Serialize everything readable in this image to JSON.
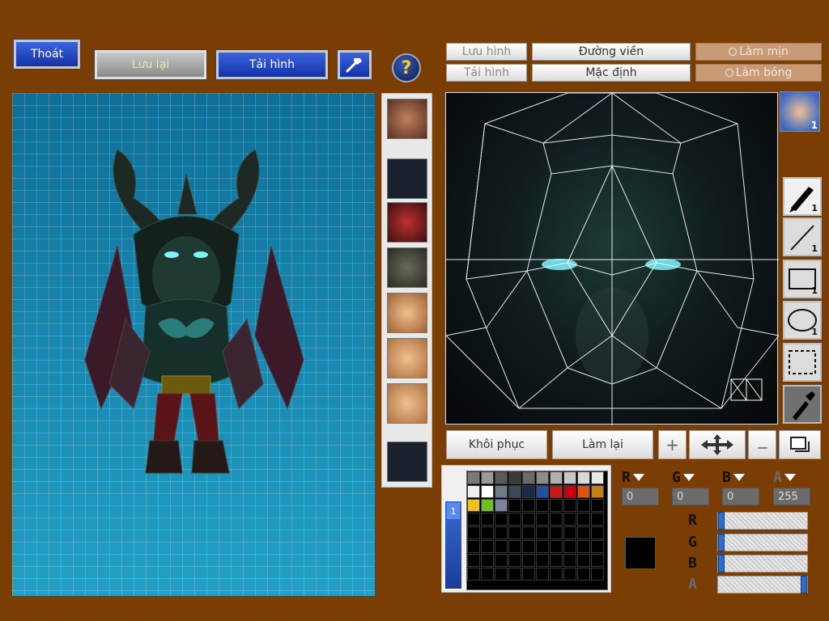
{
  "toolbar": {
    "exit_label": "Thoát",
    "save_label": "Lưu lại",
    "reload_label": "Tải hình"
  },
  "editor_tabs": {
    "save_image": "Lưu hình",
    "load_image": "Tải hình",
    "outline": "Đường viền",
    "default": "Mặc định",
    "smooth": "Làm mịn",
    "shade": "Làm bóng"
  },
  "thumbnail_badge": "1",
  "tools": [
    {
      "name": "pen",
      "count": "1"
    },
    {
      "name": "line",
      "count": "1"
    },
    {
      "name": "rectangle",
      "count": "1"
    },
    {
      "name": "ellipse",
      "count": "1"
    },
    {
      "name": "select",
      "count": ""
    },
    {
      "name": "eyedropper",
      "count": ""
    }
  ],
  "actions": {
    "restore": "Khôi phục",
    "redo": "Làm lại"
  },
  "color": {
    "r": "0",
    "g": "0",
    "b": "0",
    "a": "255",
    "r_label": "R",
    "g_label": "G",
    "b_label": "B",
    "a_label": "A",
    "current": "#000000",
    "r_level": 0,
    "g_level": 0,
    "b_level": 0,
    "a_level": 1
  },
  "palette_tab": "1",
  "palette": [
    "#7a7a7a",
    "#9a9a9a",
    "#5a5a5a",
    "#3a3a3a",
    "#6a6a6a",
    "#8c8c8c",
    "#b0b0b0",
    "#c8c8c8",
    "#d8d8d8",
    "#e8e8e8",
    "#f0f0f0",
    "#ffffff",
    "#6c7a8a",
    "#3a4858",
    "#1a2a4a",
    "#2050a0",
    "#c81818",
    "#c80010",
    "#e05010",
    "#c88010",
    "#f0c020",
    "#70c020",
    "#8080a0"
  ]
}
